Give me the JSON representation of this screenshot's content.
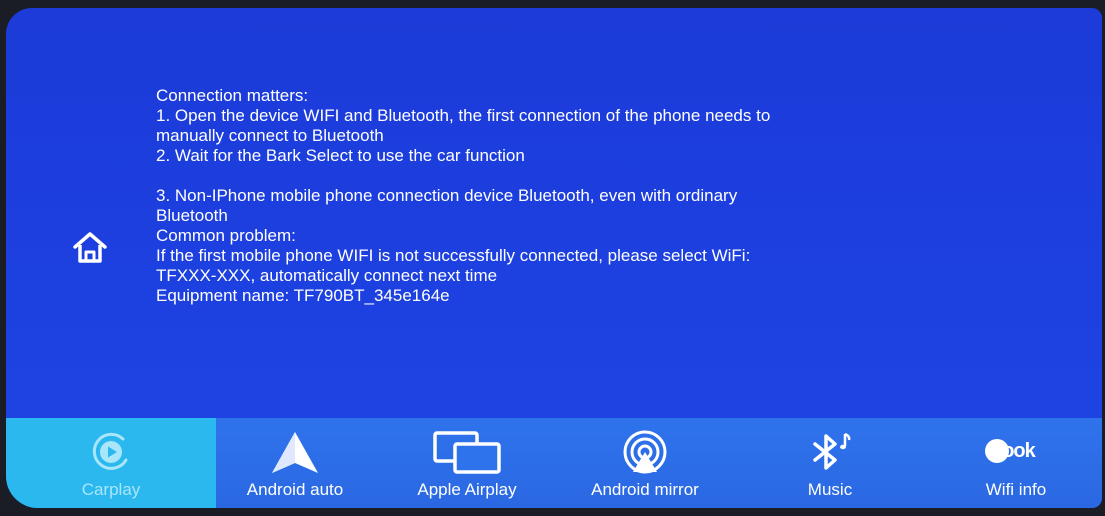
{
  "home": {
    "icon": "home-icon"
  },
  "info": {
    "lines": [
      "Connection matters:",
      "1. Open the device WIFI and Bluetooth, the first connection of the phone needs to",
      "manually connect to Bluetooth",
      "2. Wait for the Bark Select to use the car function",
      "3. Non-IPhone mobile phone connection device Bluetooth, even with ordinary",
      "Bluetooth",
      "Common problem:",
      "If the first mobile phone WIFI is not successfully connected, please select WiFi:",
      "TFXXX-XXX, automatically connect next time",
      "Equipment name:  TF790BT_345e164e"
    ]
  },
  "dock": {
    "items": [
      {
        "label": "Carplay",
        "icon": "carplay-play-icon",
        "active": true
      },
      {
        "label": "Android auto",
        "icon": "android-auto-icon",
        "active": false
      },
      {
        "label": "Apple Airplay",
        "icon": "airplay-screens-icon",
        "active": false
      },
      {
        "label": "Android mirror",
        "icon": "mirror-signal-icon",
        "active": false
      },
      {
        "label": "Music",
        "icon": "bluetooth-music-icon",
        "active": false
      },
      {
        "label": "Wifi info",
        "icon": "look-logo-icon",
        "icon_text": "Look",
        "active": false
      }
    ]
  },
  "colors": {
    "background": "#1d40e0",
    "dock": "#2f73ec",
    "active_tab": "#2ab8ee",
    "text": "#ffffff"
  }
}
